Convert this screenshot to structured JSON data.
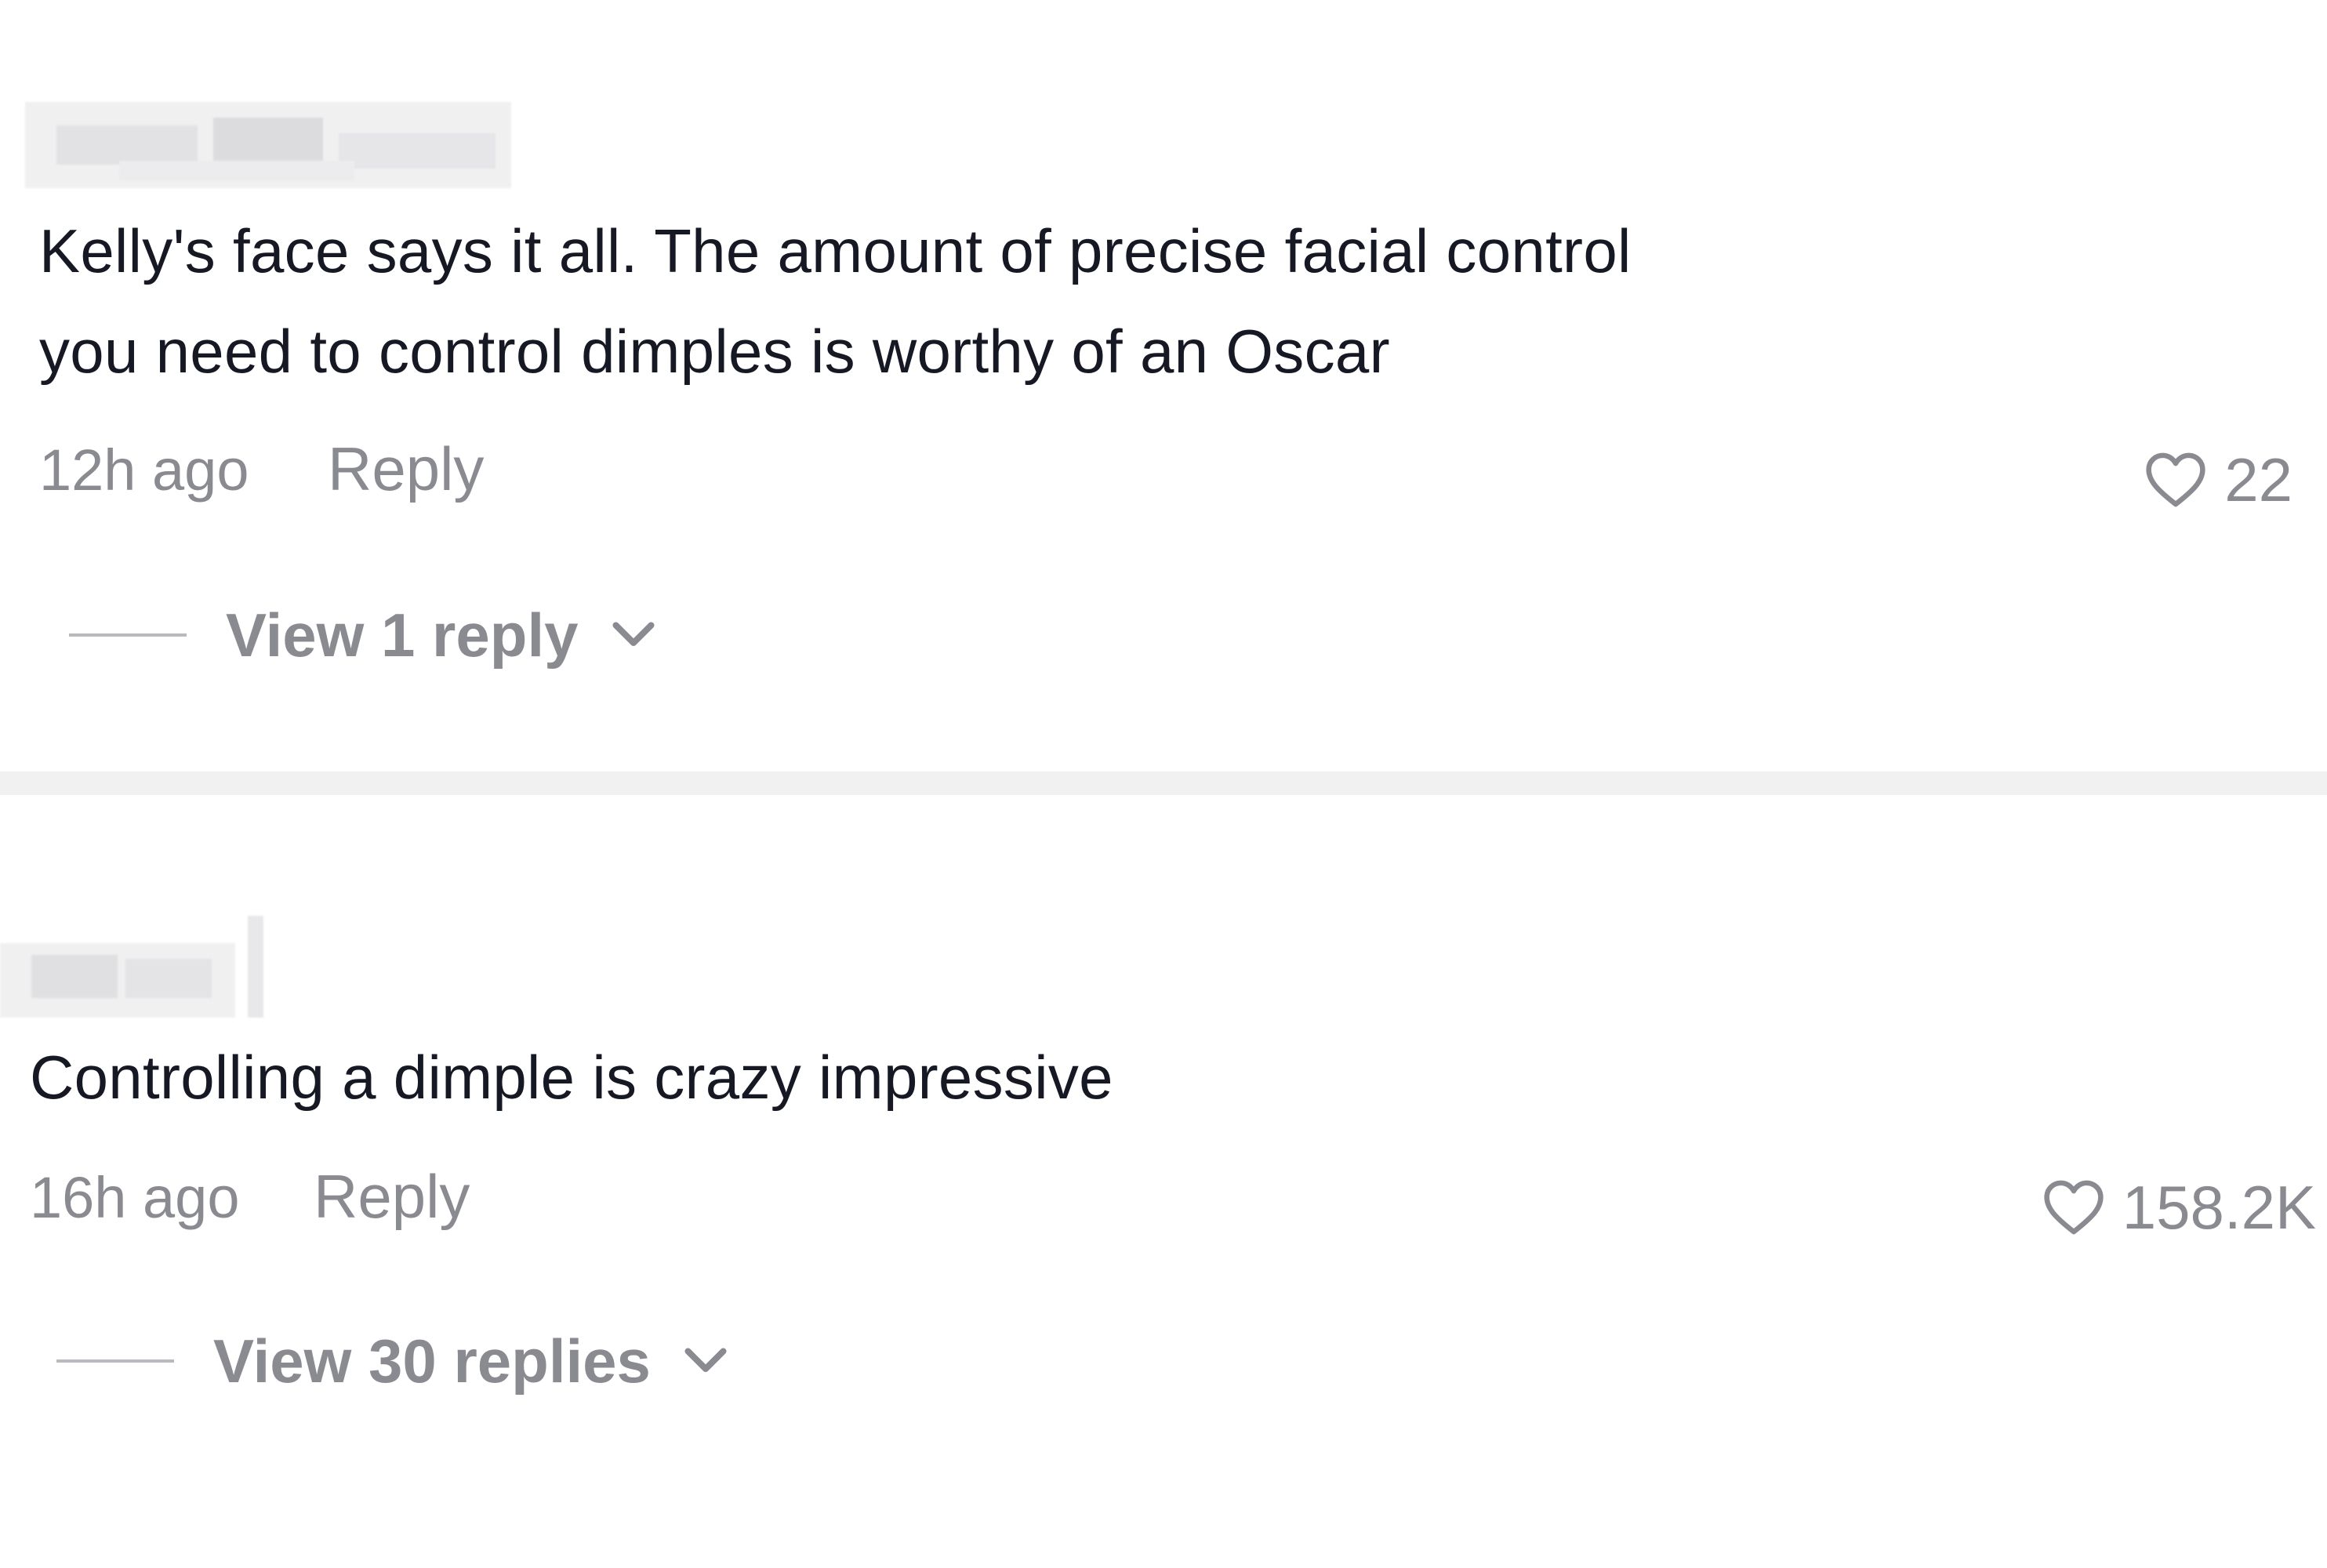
{
  "colors": {
    "primary_text": "#161823",
    "secondary_text": "#8a8b91",
    "divider": "#f1f1f2",
    "background": "#ffffff"
  },
  "comments": [
    {
      "text": "Kelly's face says it all. The amount of precise facial control\nyou need to control dimples is worthy of an Oscar",
      "timestamp": "12h ago",
      "reply_label": "Reply",
      "likes": "22",
      "view_replies_label": "View 1 reply",
      "like_icon": "heart-outline-icon",
      "expand_icon": "chevron-down-icon"
    },
    {
      "text": "Controlling a dimple is crazy impressive",
      "timestamp": "16h ago",
      "reply_label": "Reply",
      "likes": "158.2K",
      "view_replies_label": "View 30 replies",
      "like_icon": "heart-outline-icon",
      "expand_icon": "chevron-down-icon"
    }
  ]
}
